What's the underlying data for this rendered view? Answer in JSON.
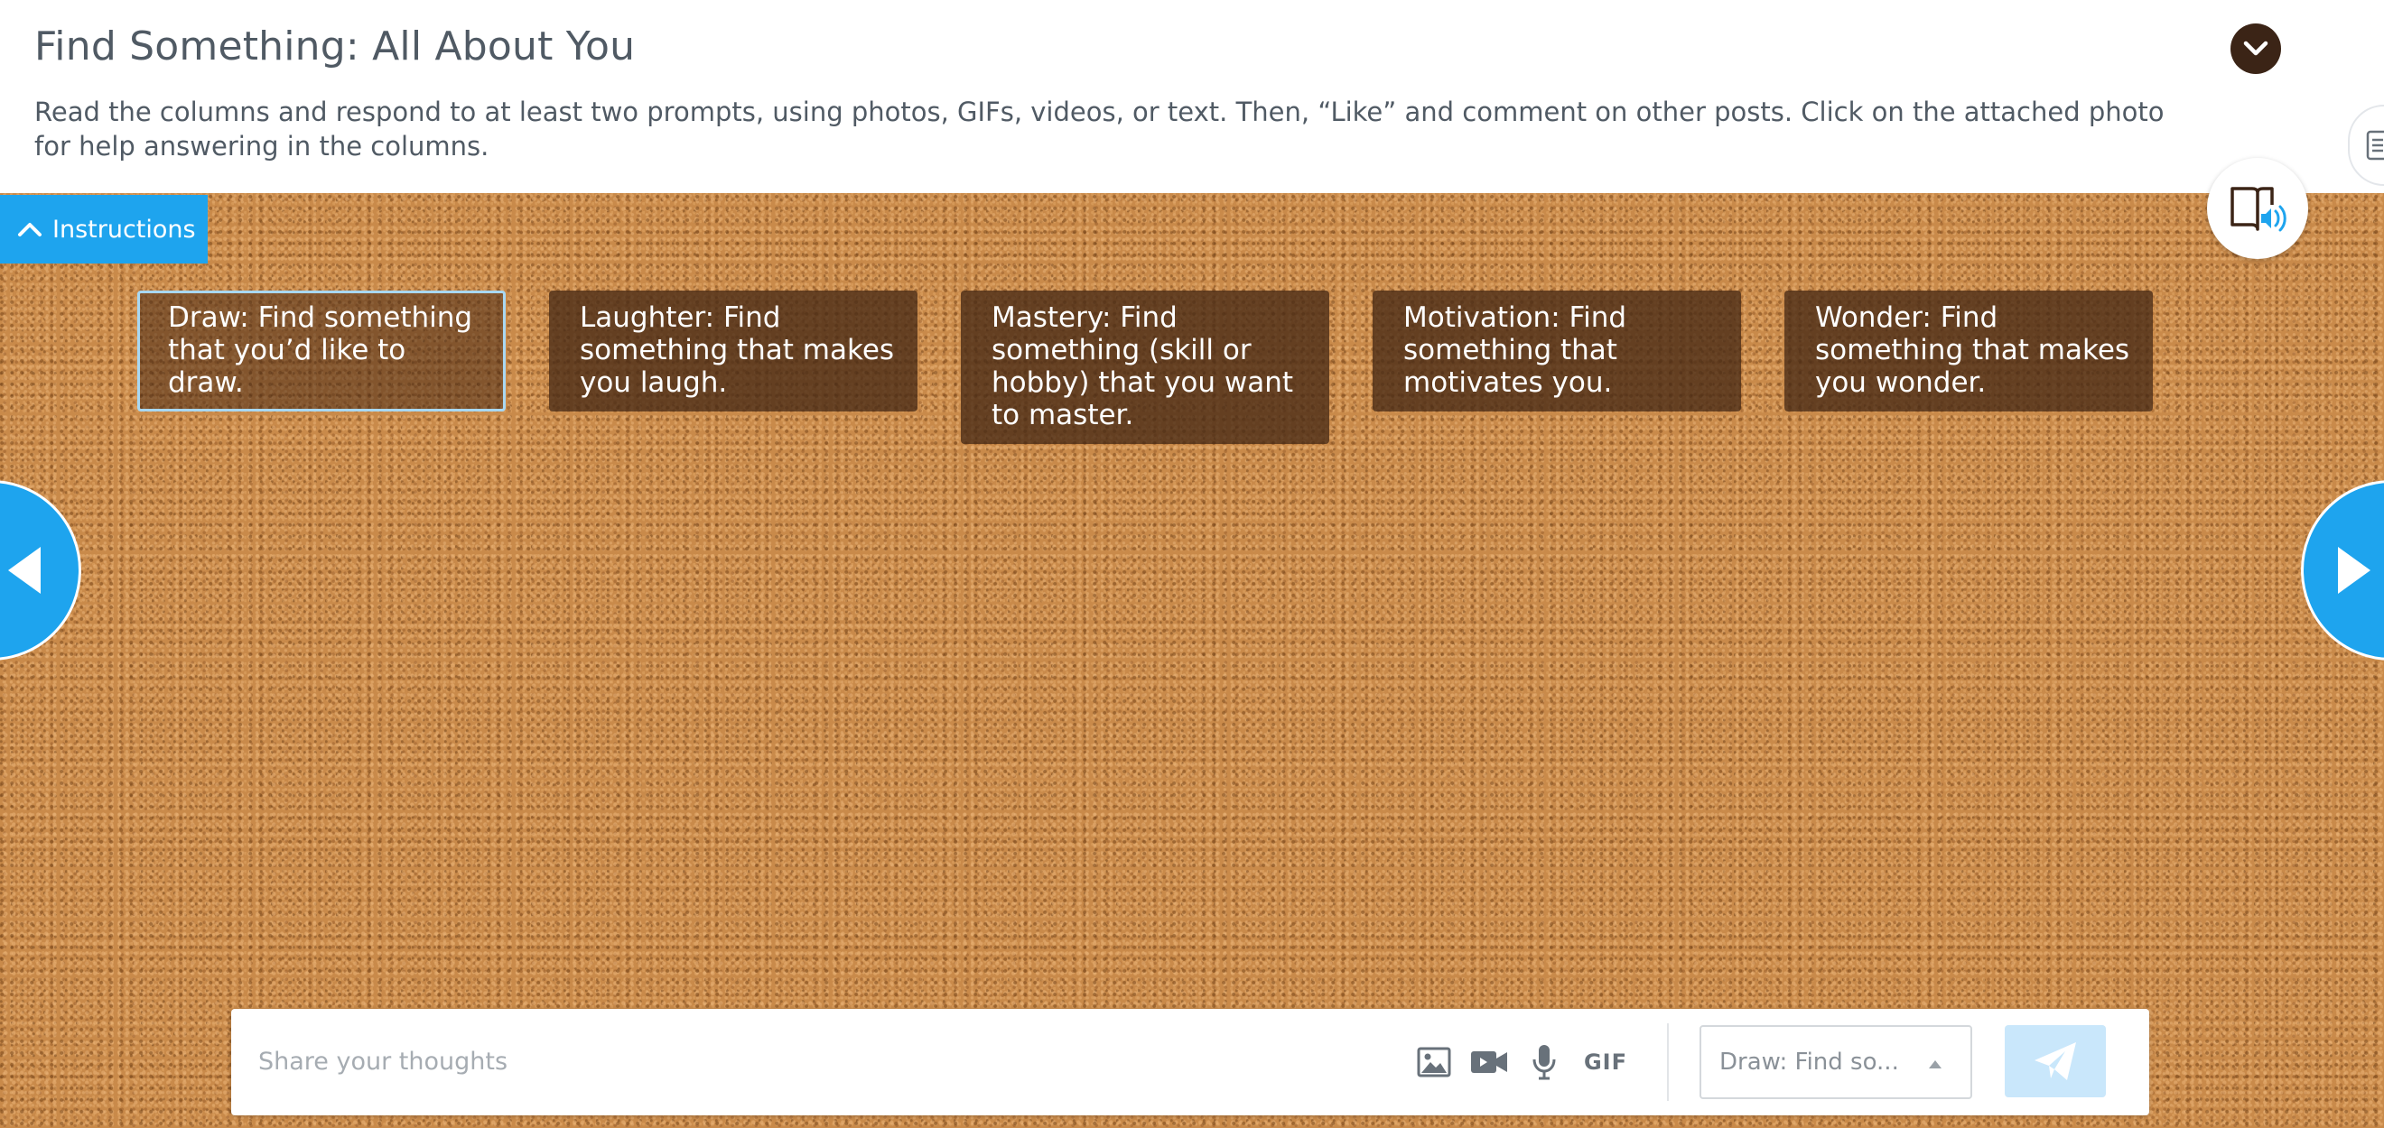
{
  "header": {
    "title": "Find Something: All About You",
    "description": "Read the columns and respond to at least two prompts, using photos, GIFs, videos, or text. Then, “Like” and comment on other posts. Click on the attached photo for help answering in the columns."
  },
  "instructions_tab": {
    "label": "Instructions"
  },
  "prompts": [
    {
      "text": "Draw: Find something that you’d like to draw.",
      "selected": true
    },
    {
      "text": "Laughter: Find something that makes you laugh.",
      "selected": false
    },
    {
      "text": "Mastery: Find something (skill or hobby) that you want to master.",
      "selected": false
    },
    {
      "text": "Motivation: Find something that motivates you.",
      "selected": false
    },
    {
      "text": "Wonder: Find something that makes you wonder.",
      "selected": false
    }
  ],
  "composer": {
    "placeholder": "Share your thoughts",
    "gif_label": "GIF",
    "column_select_value": "Draw: Find so..."
  },
  "icons": {
    "collapse": "chevron-down-icon",
    "edge": "document-icon",
    "instructions": "chevron-up-icon",
    "audio": "read-aloud-icon",
    "nav_left": "arrow-left-icon",
    "nav_right": "arrow-right-icon",
    "photo": "image-icon",
    "video": "video-camera-icon",
    "mic": "microphone-icon",
    "send": "paper-plane-icon"
  },
  "colors": {
    "accent": "#1ea4ee",
    "header_text": "#505a64",
    "collapse_button": "#3b2416",
    "card_background": "#482a16",
    "send_disabled": "#c9e7fb"
  }
}
